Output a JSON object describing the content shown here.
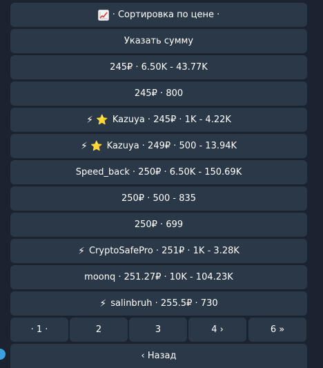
{
  "keyboard": {
    "sort_label": "· Сортировка по цене ·",
    "sort_icon": "chart-increasing-emoji",
    "custom_amount_label": "Указать сумму",
    "offers": [
      {
        "prefix": "",
        "text": "245₽ · 6.50K - 43.77K"
      },
      {
        "prefix": "",
        "text": "245₽ · 800"
      },
      {
        "prefix": "⚡ ⭐",
        "text": "Kazuya · 245₽ · 1K - 4.22K"
      },
      {
        "prefix": "⚡ ⭐",
        "text": "Kazuya · 249₽ · 500 - 13.94K"
      },
      {
        "prefix": "",
        "text": "Speed_back · 250₽ · 6.50K - 150.69K"
      },
      {
        "prefix": "",
        "text": "250₽ · 500 - 835"
      },
      {
        "prefix": "",
        "text": "250₽ · 699"
      },
      {
        "prefix": "⚡",
        "text": "CryptoSafePro · 251₽ · 1K - 3.28K"
      },
      {
        "prefix": "",
        "text": "moonq · 251.27₽ · 10K - 104.23K"
      },
      {
        "prefix": "⚡",
        "text": "salinbruh · 255.5₽ · 730"
      }
    ],
    "pages": [
      "· 1 ·",
      "2",
      "3",
      "4 ›",
      "6 »"
    ],
    "back_label": "‹ Назад"
  },
  "colors": {
    "background": "#1a232f",
    "button": "#2b3847",
    "text": "#ffffff",
    "accent": "#3aa1e0"
  }
}
